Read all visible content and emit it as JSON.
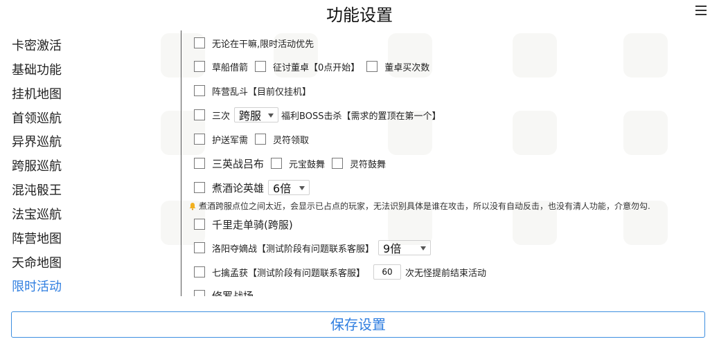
{
  "header": {
    "title": "功能设置"
  },
  "sidebar": {
    "items": [
      {
        "label": "卡密激活"
      },
      {
        "label": "基础功能"
      },
      {
        "label": "挂机地图"
      },
      {
        "label": "首领巡航"
      },
      {
        "label": "异界巡航"
      },
      {
        "label": "跨服巡航"
      },
      {
        "label": "混沌骰王"
      },
      {
        "label": "法宝巡航"
      },
      {
        "label": "阵营地图"
      },
      {
        "label": "天命地图"
      },
      {
        "label": "限时活动"
      }
    ],
    "active": "限时活动"
  },
  "options": {
    "r1": {
      "a": "无论在干嘛,限时活动优先"
    },
    "r2": {
      "a": "草船借箭",
      "b": "征讨董卓【0点开始】",
      "c": "董卓买次数"
    },
    "r3": {
      "a": "阵营乱斗【目前仅挂机】"
    },
    "r4": {
      "a": "三次",
      "select": "跨服",
      "b": "福利BOSS击杀【需求的置顶在第一个】"
    },
    "r5": {
      "a": "护送军需",
      "b": "灵符领取"
    },
    "r6": {
      "a": "三英战吕布",
      "b": "元宝鼓舞",
      "c": "灵符鼓舞"
    },
    "r7": {
      "a": "煮酒论英雄",
      "select": "6倍"
    },
    "note": "煮酒跨服点位之间太近，会显示已占点的玩家，无法识别具体是谁在攻击，所以没有自动反击，也没有清人功能，介意勿勾.",
    "r8": {
      "a": "千里走单骑(跨服)"
    },
    "r9": {
      "a": "洛阳夺嫡战【测试阶段有问题联系客服】",
      "select": "9倍"
    },
    "r10": {
      "a": "七擒孟获【测试阶段有问题联系客服】",
      "input": "60",
      "b": "次无怪提前结束活动"
    },
    "r11": {
      "a": "修罗战场"
    }
  },
  "footer": {
    "save_label": "保存设置"
  },
  "colors": {
    "accent": "#2f7ee0",
    "divider": "#555555"
  }
}
